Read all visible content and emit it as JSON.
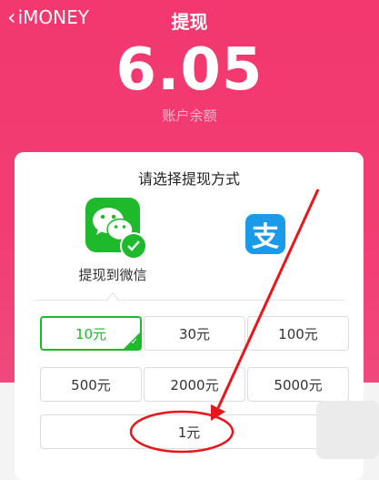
{
  "header": {
    "back_label": "iMONEY",
    "title": "提现",
    "balance": "6.05",
    "balance_label": "账户余额"
  },
  "methods": {
    "prompt": "请选择提现方式",
    "wechat_label": "提现到微信",
    "alipay_glyph": "支",
    "selected": "wechat"
  },
  "amounts": [
    {
      "label": "10元",
      "selected": true
    },
    {
      "label": "30元",
      "selected": false
    },
    {
      "label": "100元",
      "selected": false
    },
    {
      "label": "500元",
      "selected": false
    },
    {
      "label": "2000元",
      "selected": false
    },
    {
      "label": "5000元",
      "selected": false
    }
  ],
  "custom_amount": "1元",
  "colors": {
    "brand_pink": "#f23d73",
    "wechat_green": "#1fb92c",
    "alipay_blue": "#1a9be9",
    "annotation_red": "#e8151b"
  },
  "icons": [
    "chevron-left-icon",
    "wechat-icon",
    "check-icon",
    "alipay-icon"
  ]
}
